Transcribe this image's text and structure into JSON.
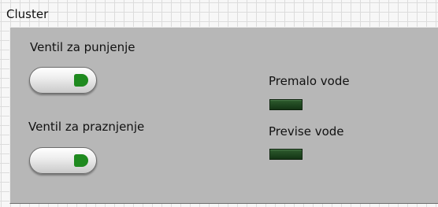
{
  "cluster": {
    "label": "Cluster"
  },
  "controls": {
    "fill_valve": {
      "label": "Ventil za punjenje",
      "state": "off",
      "light_color": "#1f8a1f"
    },
    "drain_valve": {
      "label": "Ventil za praznjenje",
      "state": "off",
      "light_color": "#1f8a1f"
    }
  },
  "indicators": {
    "low_water": {
      "label": "Premalo vode",
      "state": "off",
      "color": "#1f4620"
    },
    "high_water": {
      "label": "Previse vode",
      "state": "off",
      "color": "#1f4620"
    }
  },
  "colors": {
    "cluster_background": "#b7b7b7",
    "panel_background": "#f7f7f7",
    "grid_line": "#dcdcdc"
  }
}
